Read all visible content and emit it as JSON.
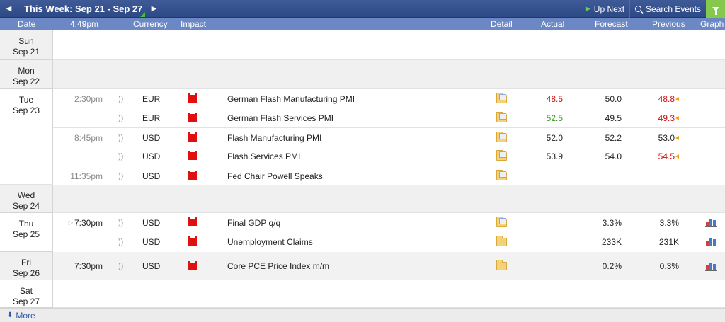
{
  "toolbar": {
    "week_label": "This Week: Sep 21 - Sep 27",
    "prev_icon": "chevron-left-icon",
    "next_icon": "chevron-right-icon",
    "up_next_label": "Up Next",
    "search_label": "Search Events",
    "filter_icon": "filter-icon",
    "filter_color": "#86c84b"
  },
  "header": {
    "date": "Date",
    "time": "4:49pm",
    "currency": "Currency",
    "impact": "Impact",
    "detail": "Detail",
    "actual": "Actual",
    "forecast": "Forecast",
    "previous": "Previous",
    "graph": "Graph"
  },
  "days": [
    {
      "day": "Sun",
      "date": "Sep 21"
    },
    {
      "day": "Mon",
      "date": "Sep 22"
    },
    {
      "day": "Tue",
      "date": "Sep 23"
    },
    {
      "day": "Wed",
      "date": "Sep 24"
    },
    {
      "day": "Thu",
      "date": "Sep 25"
    },
    {
      "day": "Fri",
      "date": "Sep 26"
    },
    {
      "day": "Sat",
      "date": "Sep 27"
    }
  ],
  "events": [
    {
      "time": "2:30pm",
      "currency": "EUR",
      "impact": "high",
      "name": "German Flash Manufacturing PMI",
      "actual": "48.5",
      "actual_color": "red",
      "forecast": "50.0",
      "previous": "48.8",
      "previous_color": "red",
      "revised": true
    },
    {
      "time": "",
      "currency": "EUR",
      "impact": "high",
      "name": "German Flash Services PMI",
      "actual": "52.5",
      "actual_color": "green",
      "forecast": "49.5",
      "previous": "49.3",
      "previous_color": "red",
      "revised": true
    },
    {
      "time": "8:45pm",
      "currency": "USD",
      "impact": "high",
      "name": "Flash Manufacturing PMI",
      "actual": "52.0",
      "actual_color": "black",
      "forecast": "52.2",
      "previous": "53.0",
      "previous_color": "black",
      "revised": true
    },
    {
      "time": "",
      "currency": "USD",
      "impact": "high",
      "name": "Flash Services PMI",
      "actual": "53.9",
      "actual_color": "black",
      "forecast": "54.0",
      "previous": "54.5",
      "previous_color": "red",
      "revised": true
    },
    {
      "time": "11:35pm",
      "currency": "USD",
      "impact": "high",
      "name": "Fed Chair Powell Speaks",
      "actual": "",
      "forecast": "",
      "previous": ""
    },
    {
      "time": "7:30pm",
      "currency": "USD",
      "impact": "high",
      "name": "Final GDP q/q",
      "actual": "",
      "forecast": "3.3%",
      "previous": "3.3%",
      "graph": true,
      "up_next": true
    },
    {
      "time": "",
      "currency": "USD",
      "impact": "high",
      "name": "Unemployment Claims",
      "actual": "",
      "forecast": "233K",
      "previous": "231K",
      "graph": true
    },
    {
      "time": "7:30pm",
      "currency": "USD",
      "impact": "high",
      "name": "Core PCE Price Index m/m",
      "actual": "",
      "forecast": "0.2%",
      "previous": "0.3%",
      "graph": true
    }
  ],
  "footer": {
    "more_label": "More"
  },
  "colors": {
    "header_bg": "#2e4a86",
    "subheader_bg": "#6b87c4",
    "high_impact": "#e01010",
    "better": "#3a9a1e",
    "worse": "#cc1111"
  }
}
